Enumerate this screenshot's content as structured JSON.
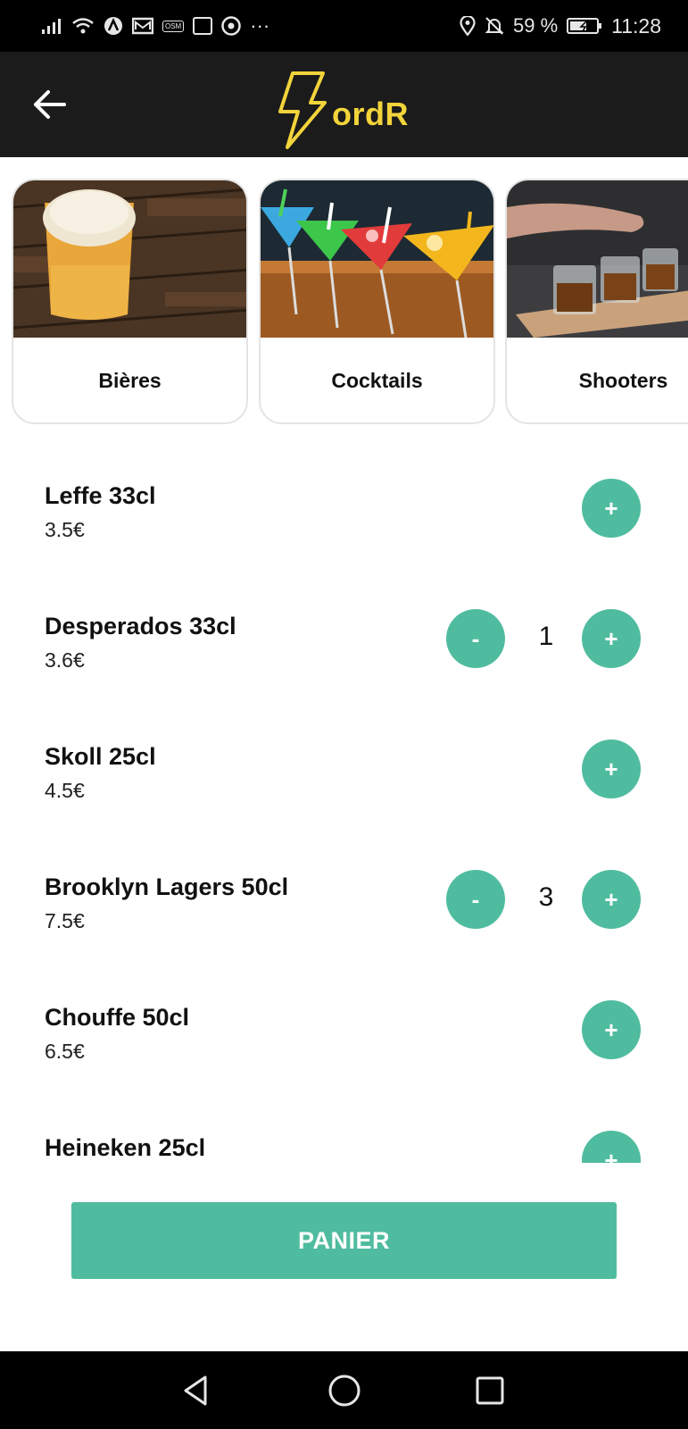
{
  "status_bar": {
    "battery": "59 %",
    "time": "11:28",
    "more": "···",
    "osm": "OSM"
  },
  "app_bar": {
    "logo_text": "ordR"
  },
  "categories": [
    {
      "label": "Bières",
      "image": "beer-photo"
    },
    {
      "label": "Cocktails",
      "image": "cocktails-photo"
    },
    {
      "label": "Shooters",
      "image": "shooters-photo"
    }
  ],
  "products": [
    {
      "name": "Leffe 33cl",
      "price": "3.5€",
      "quantity": null
    },
    {
      "name": "Desperados 33cl",
      "price": "3.6€",
      "quantity": "1"
    },
    {
      "name": "Skoll 25cl",
      "price": "4.5€",
      "quantity": null
    },
    {
      "name": "Brooklyn Lagers 50cl",
      "price": "7.5€",
      "quantity": "3"
    },
    {
      "name": "Chouffe 50cl",
      "price": "6.5€",
      "quantity": null
    },
    {
      "name": "Heineken 25cl",
      "price": "",
      "quantity": null
    }
  ],
  "buttons": {
    "plus": "+",
    "minus": "-"
  },
  "panier_label": "PANIER",
  "colors": {
    "accent": "#50bc9f",
    "brand_yellow": "#f2d43b",
    "app_bar": "#1b1b1b"
  }
}
